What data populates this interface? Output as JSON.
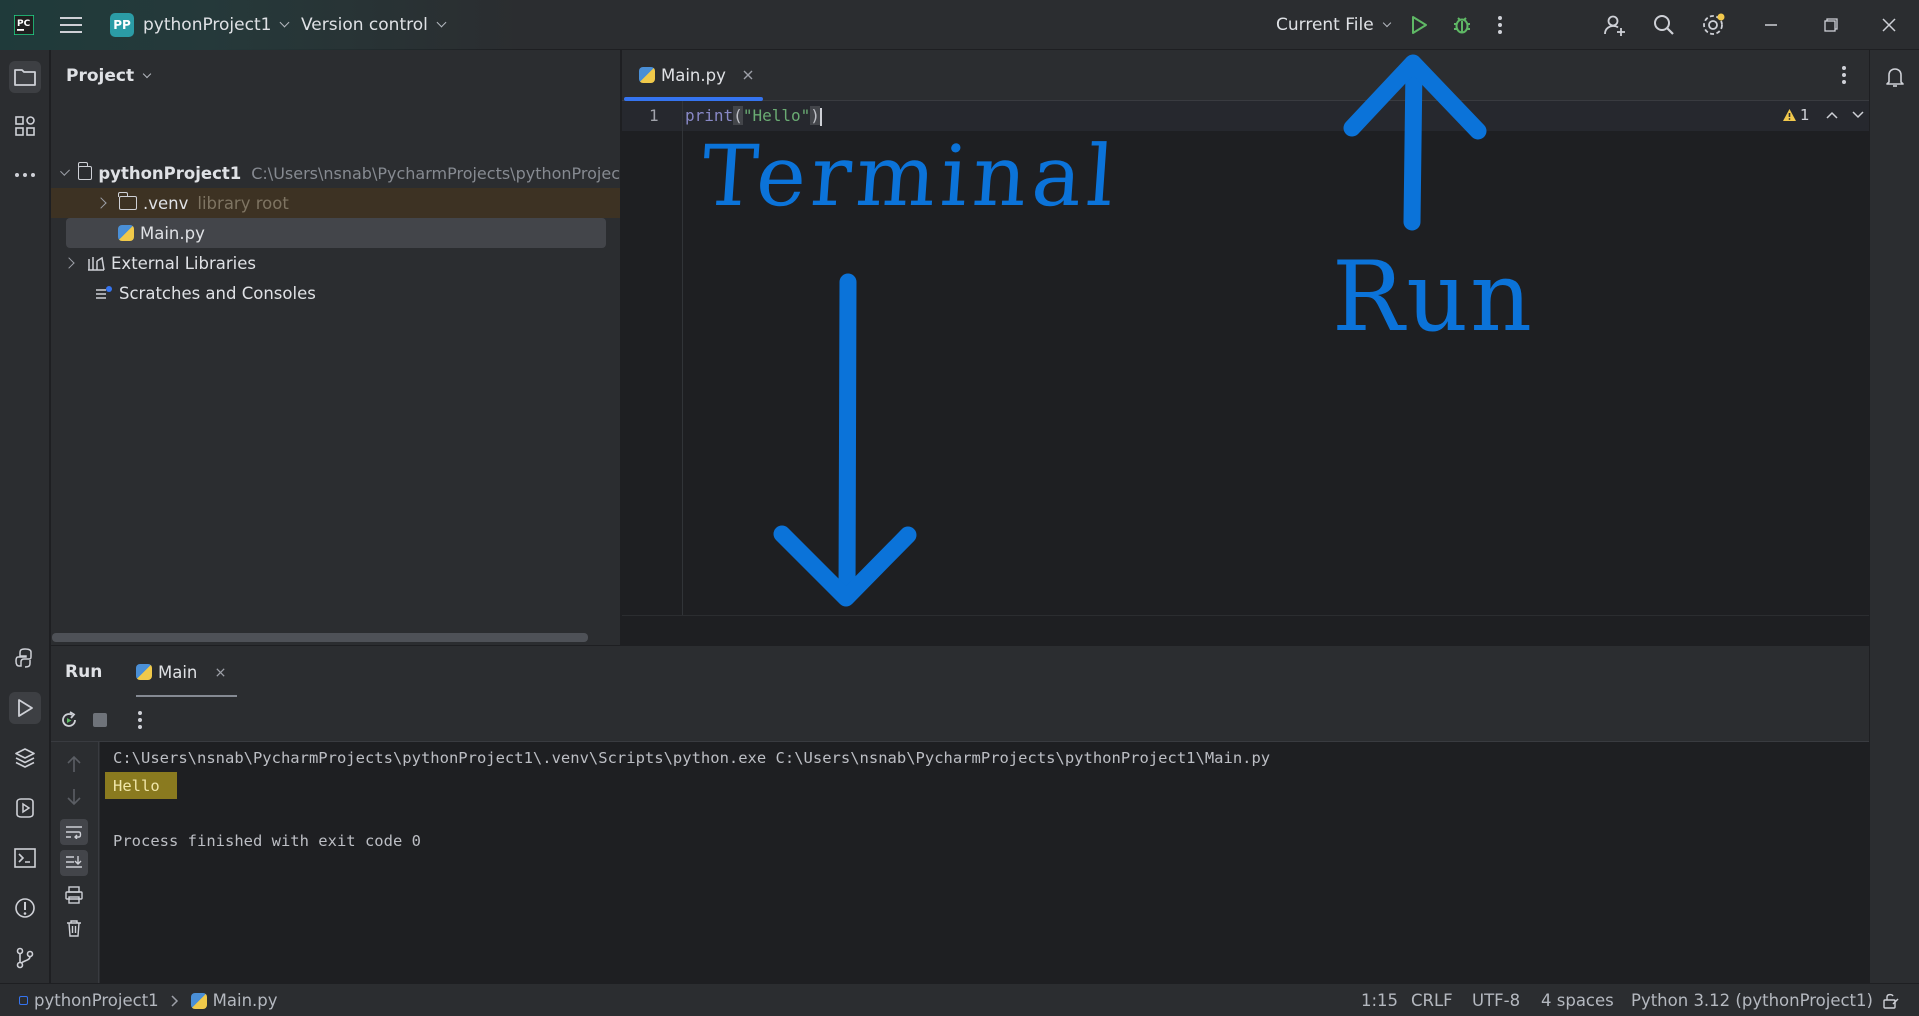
{
  "titlebar": {
    "project_badge": "PP",
    "project_name": "pythonProject1",
    "version_control": "Version control",
    "run_config": "Current File",
    "window_controls": [
      "minimize",
      "restore",
      "close"
    ]
  },
  "project_panel": {
    "title": "Project",
    "tree": [
      {
        "label": "pythonProject1",
        "detail": "C:\\Users\\nsnab\\PycharmProjects\\pythonProjec",
        "kind": "folder",
        "expanded": true
      },
      {
        "label": ".venv",
        "detail": "library root",
        "kind": "folder",
        "expanded": false
      },
      {
        "label": "Main.py",
        "detail": "",
        "kind": "python-file",
        "selected": true
      },
      {
        "label": "External Libraries",
        "detail": "",
        "kind": "libraries",
        "expanded": false
      },
      {
        "label": "Scratches and Consoles",
        "detail": "",
        "kind": "scratches"
      }
    ]
  },
  "editor": {
    "tab_label": "Main.py",
    "line_number": "1",
    "code": {
      "fn": "print",
      "open": "(",
      "string": "\"Hello\"",
      "close": ")"
    },
    "inspection_count": "1",
    "annotations": {
      "left_text": "Terminal",
      "right_text": "Run"
    }
  },
  "run_panel": {
    "title": "Run",
    "tab_label": "Main",
    "console": {
      "command": "C:\\Users\\nsnab\\PycharmProjects\\pythonProject1\\.venv\\Scripts\\python.exe C:\\Users\\nsnab\\PycharmProjects\\pythonProject1\\Main.py",
      "output": "Hello",
      "exit_message": "Process finished with exit code 0"
    }
  },
  "statusbar": {
    "breadcrumb_project": "pythonProject1",
    "breadcrumb_file": "Main.py",
    "position": "1:15",
    "line_ending": "CRLF",
    "encoding": "UTF-8",
    "indent": "4 spaces",
    "interpreter": "Python 3.12 (pythonProject1)"
  },
  "colors": {
    "accent": "#3574f0",
    "run_green": "#5fb865",
    "annotation_blue": "#0b73d9",
    "highlight": "#8a7a1f"
  }
}
